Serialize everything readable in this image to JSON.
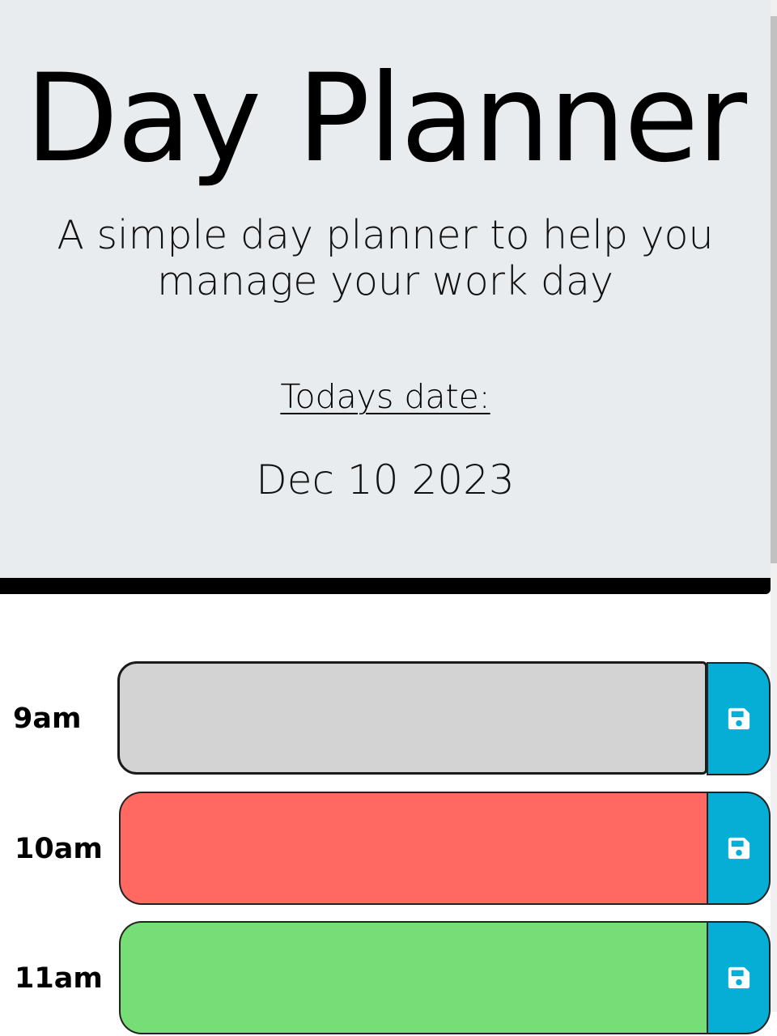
{
  "header": {
    "title": "Day Planner",
    "lead": "A simple day planner to help you manage your work day",
    "date_label": "Todays date:",
    "current_date": "Dec 10 2023"
  },
  "colors": {
    "jumbotron_bg": "#e9ecef",
    "past": "#d3d3d3",
    "present": "#ff6961",
    "future": "#77dd77",
    "save_button": "#06aed5"
  },
  "time_blocks": [
    {
      "hour": "9am",
      "state": "past",
      "text": "",
      "save_icon": "floppy-disk-icon"
    },
    {
      "hour": "10am",
      "state": "present",
      "text": "",
      "save_icon": "floppy-disk-icon"
    },
    {
      "hour": "11am",
      "state": "future",
      "text": "",
      "save_icon": "floppy-disk-icon"
    }
  ]
}
